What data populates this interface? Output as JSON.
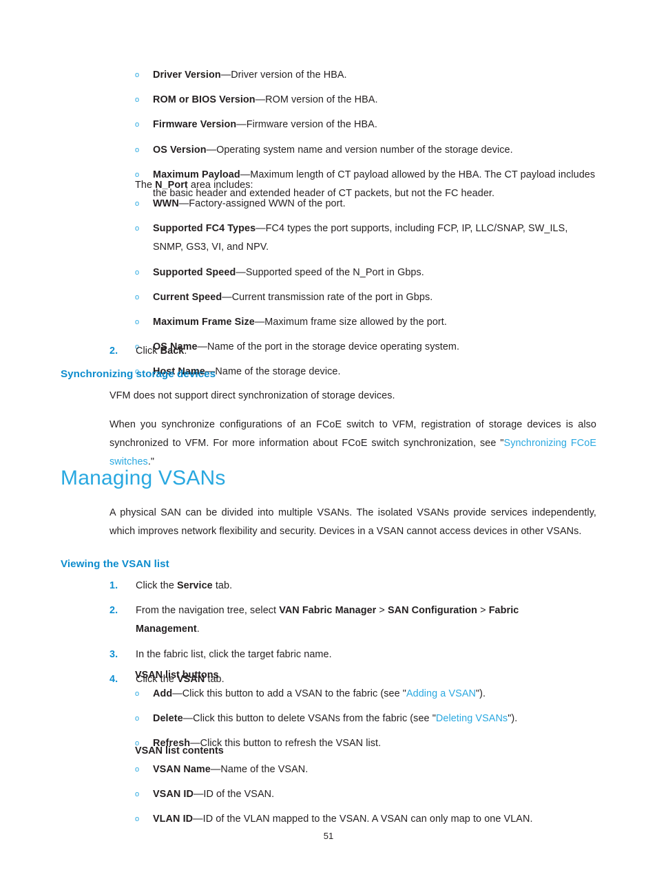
{
  "page": {
    "number": "51",
    "bullet_marker": "o"
  },
  "colors": {
    "heading_h1": "#29a8e0",
    "heading_h3": "#0d8ccd",
    "link": "#29a8e0",
    "list_number": "#0e8fd2",
    "bullet": "#29a8e0",
    "body_text": "#231f20"
  },
  "hba_fields": [
    {
      "term": "Driver Version",
      "dash": "—",
      "desc": "Driver version of the HBA."
    },
    {
      "term": "ROM or BIOS Version",
      "dash": "—",
      "desc": "ROM version of the HBA."
    },
    {
      "term": "Firmware Version",
      "dash": "—",
      "desc": "Firmware version of the HBA."
    },
    {
      "term": "OS Version",
      "dash": "—",
      "desc": "Operating system name and version number of the storage device."
    },
    {
      "term": "Maximum Payload",
      "dash": "—",
      "desc": "Maximum length of CT payload allowed by the HBA. The CT payload includes the basic header and extended header of CT packets, but not the FC header."
    }
  ],
  "nport_intro": {
    "before": "The ",
    "term": "N_Port",
    "after": " area includes:"
  },
  "nport_fields": [
    {
      "term": "WWN",
      "dash": "—",
      "desc": "Factory-assigned WWN of the port."
    },
    {
      "term": "Supported FC4 Types",
      "dash": "—",
      "desc": "FC4 types the port supports, including FCP, IP, LLC/SNAP, SW_ILS, SNMP, GS3, VI, and NPV."
    },
    {
      "term": "Supported Speed",
      "dash": "—",
      "desc": "Supported speed of the N_Port in Gbps."
    },
    {
      "term": "Current Speed",
      "dash": "—",
      "desc": "Current transmission rate of the port in Gbps."
    },
    {
      "term": "Maximum Frame Size",
      "dash": "—",
      "desc": "Maximum frame size allowed by the port."
    },
    {
      "term": "OS Name",
      "dash": "—",
      "desc": "Name of the port in the storage device operating system."
    },
    {
      "term": "Host Name",
      "dash": "—",
      "desc": "Name of the storage device."
    }
  ],
  "step_back": {
    "number": "2.",
    "before": "Click ",
    "term": "Back",
    "after": "."
  },
  "sync_section": {
    "heading": "Synchronizing storage devices",
    "para1": "VFM does not support direct synchronization of storage devices.",
    "para2_before": "When you synchronize configurations of an FCoE switch to VFM, registration of storage devices is also synchronized to VFM. For more information about FCoE switch synchronization, see \"",
    "para2_link": "Synchronizing FCoE switches",
    "para2_after": ".\""
  },
  "vsan_section": {
    "heading": "Managing VSANs",
    "intro": "A physical SAN can be divided into multiple VSANs. The isolated VSANs provide services independently, which improves network flexibility and security. Devices in a VSAN cannot access devices in other VSANs."
  },
  "viewing_section": {
    "heading": "Viewing the VSAN list",
    "steps": [
      {
        "number": "1.",
        "segments": [
          {
            "text": "Click the ",
            "bold": false
          },
          {
            "text": "Service",
            "bold": true
          },
          {
            "text": " tab.",
            "bold": false
          }
        ]
      },
      {
        "number": "2.",
        "segments": [
          {
            "text": "From the navigation tree, select ",
            "bold": false
          },
          {
            "text": "VAN Fabric Manager",
            "bold": true
          },
          {
            "text": " > ",
            "bold": false
          },
          {
            "text": "SAN Configuration",
            "bold": true
          },
          {
            "text": " > ",
            "bold": false
          },
          {
            "text": "Fabric Management",
            "bold": true
          },
          {
            "text": ".",
            "bold": false
          }
        ]
      },
      {
        "number": "3.",
        "segments": [
          {
            "text": "In the fabric list, click the target fabric name.",
            "bold": false
          }
        ]
      },
      {
        "number": "4.",
        "segments": [
          {
            "text": "Click the ",
            "bold": false
          },
          {
            "text": "VSAN",
            "bold": true
          },
          {
            "text": " tab.",
            "bold": false
          }
        ]
      }
    ],
    "buttons_subhead": "VSAN list buttons",
    "buttons": [
      {
        "term": "Add",
        "dash": "—",
        "desc_before": "Click this button to add a VSAN to the fabric (see \"",
        "link": "Adding a VSAN",
        "desc_after": "\")."
      },
      {
        "term": "Delete",
        "dash": "—",
        "desc_before": "Click this button to delete VSANs from the fabric (see \"",
        "link": "Deleting VSANs",
        "desc_after": "\")."
      },
      {
        "term": "Refresh",
        "dash": "—",
        "desc_before": "Click this button to refresh the VSAN list.",
        "link": "",
        "desc_after": ""
      }
    ],
    "contents_subhead": "VSAN list contents",
    "contents": [
      {
        "term": "VSAN Name",
        "dash": "—",
        "desc": "Name of the VSAN."
      },
      {
        "term": "VSAN ID",
        "dash": "—",
        "desc": "ID of the VSAN."
      },
      {
        "term": "VLAN ID",
        "dash": "—",
        "desc": "ID of the VLAN mapped to the VSAN. A VSAN can only map to one VLAN."
      }
    ]
  }
}
